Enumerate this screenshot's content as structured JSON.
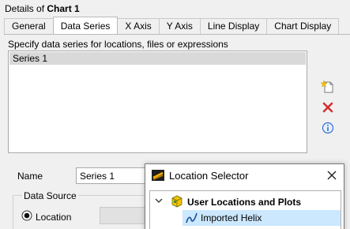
{
  "header": {
    "prefix": "Details of ",
    "chart_name": "Chart 1"
  },
  "tabs": [
    {
      "label": "General"
    },
    {
      "label": "Data Series"
    },
    {
      "label": "X Axis"
    },
    {
      "label": "Y Axis"
    },
    {
      "label": "Line Display"
    },
    {
      "label": "Chart Display"
    }
  ],
  "active_tab": "Data Series",
  "data_series": {
    "hint": "Specify data series for locations, files or expressions",
    "series": [
      {
        "label": "Series 1"
      }
    ],
    "side_icons": [
      "new-series-icon",
      "delete-icon",
      "info-icon"
    ]
  },
  "name_field": {
    "label": "Name",
    "value": "Series 1"
  },
  "data_source": {
    "legend": "Data Source",
    "location_label": "Location",
    "location_selected": true
  },
  "location_selector": {
    "title": "Location Selector",
    "group_label": "User Locations and Plots",
    "items": [
      {
        "label": "Imported Helix"
      }
    ]
  },
  "colors": {
    "accent_selection": "#cce8ff",
    "series_selected": "#d9d9d9",
    "delete_red": "#d32f2f",
    "info_blue": "#2f6fd0"
  }
}
